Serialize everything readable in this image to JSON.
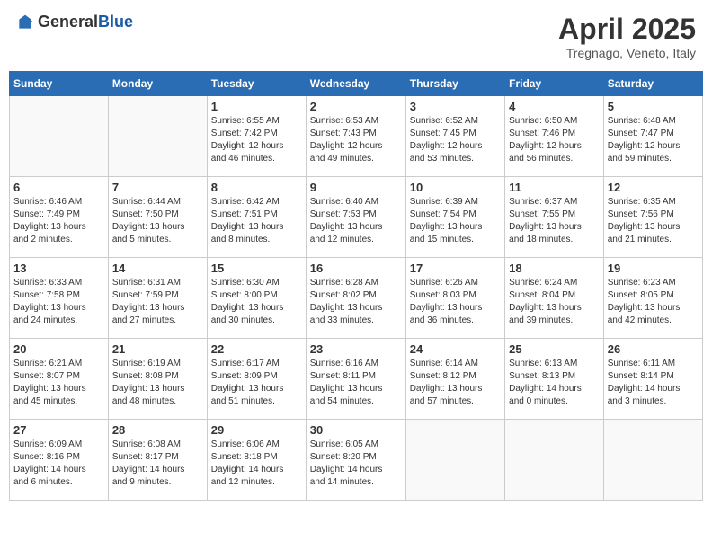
{
  "header": {
    "logo_general": "General",
    "logo_blue": "Blue",
    "title": "April 2025",
    "location": "Tregnago, Veneto, Italy"
  },
  "days_of_week": [
    "Sunday",
    "Monday",
    "Tuesday",
    "Wednesday",
    "Thursday",
    "Friday",
    "Saturday"
  ],
  "weeks": [
    [
      {
        "day": "",
        "info": ""
      },
      {
        "day": "",
        "info": ""
      },
      {
        "day": "1",
        "info": "Sunrise: 6:55 AM\nSunset: 7:42 PM\nDaylight: 12 hours\nand 46 minutes."
      },
      {
        "day": "2",
        "info": "Sunrise: 6:53 AM\nSunset: 7:43 PM\nDaylight: 12 hours\nand 49 minutes."
      },
      {
        "day": "3",
        "info": "Sunrise: 6:52 AM\nSunset: 7:45 PM\nDaylight: 12 hours\nand 53 minutes."
      },
      {
        "day": "4",
        "info": "Sunrise: 6:50 AM\nSunset: 7:46 PM\nDaylight: 12 hours\nand 56 minutes."
      },
      {
        "day": "5",
        "info": "Sunrise: 6:48 AM\nSunset: 7:47 PM\nDaylight: 12 hours\nand 59 minutes."
      }
    ],
    [
      {
        "day": "6",
        "info": "Sunrise: 6:46 AM\nSunset: 7:49 PM\nDaylight: 13 hours\nand 2 minutes."
      },
      {
        "day": "7",
        "info": "Sunrise: 6:44 AM\nSunset: 7:50 PM\nDaylight: 13 hours\nand 5 minutes."
      },
      {
        "day": "8",
        "info": "Sunrise: 6:42 AM\nSunset: 7:51 PM\nDaylight: 13 hours\nand 8 minutes."
      },
      {
        "day": "9",
        "info": "Sunrise: 6:40 AM\nSunset: 7:53 PM\nDaylight: 13 hours\nand 12 minutes."
      },
      {
        "day": "10",
        "info": "Sunrise: 6:39 AM\nSunset: 7:54 PM\nDaylight: 13 hours\nand 15 minutes."
      },
      {
        "day": "11",
        "info": "Sunrise: 6:37 AM\nSunset: 7:55 PM\nDaylight: 13 hours\nand 18 minutes."
      },
      {
        "day": "12",
        "info": "Sunrise: 6:35 AM\nSunset: 7:56 PM\nDaylight: 13 hours\nand 21 minutes."
      }
    ],
    [
      {
        "day": "13",
        "info": "Sunrise: 6:33 AM\nSunset: 7:58 PM\nDaylight: 13 hours\nand 24 minutes."
      },
      {
        "day": "14",
        "info": "Sunrise: 6:31 AM\nSunset: 7:59 PM\nDaylight: 13 hours\nand 27 minutes."
      },
      {
        "day": "15",
        "info": "Sunrise: 6:30 AM\nSunset: 8:00 PM\nDaylight: 13 hours\nand 30 minutes."
      },
      {
        "day": "16",
        "info": "Sunrise: 6:28 AM\nSunset: 8:02 PM\nDaylight: 13 hours\nand 33 minutes."
      },
      {
        "day": "17",
        "info": "Sunrise: 6:26 AM\nSunset: 8:03 PM\nDaylight: 13 hours\nand 36 minutes."
      },
      {
        "day": "18",
        "info": "Sunrise: 6:24 AM\nSunset: 8:04 PM\nDaylight: 13 hours\nand 39 minutes."
      },
      {
        "day": "19",
        "info": "Sunrise: 6:23 AM\nSunset: 8:05 PM\nDaylight: 13 hours\nand 42 minutes."
      }
    ],
    [
      {
        "day": "20",
        "info": "Sunrise: 6:21 AM\nSunset: 8:07 PM\nDaylight: 13 hours\nand 45 minutes."
      },
      {
        "day": "21",
        "info": "Sunrise: 6:19 AM\nSunset: 8:08 PM\nDaylight: 13 hours\nand 48 minutes."
      },
      {
        "day": "22",
        "info": "Sunrise: 6:17 AM\nSunset: 8:09 PM\nDaylight: 13 hours\nand 51 minutes."
      },
      {
        "day": "23",
        "info": "Sunrise: 6:16 AM\nSunset: 8:11 PM\nDaylight: 13 hours\nand 54 minutes."
      },
      {
        "day": "24",
        "info": "Sunrise: 6:14 AM\nSunset: 8:12 PM\nDaylight: 13 hours\nand 57 minutes."
      },
      {
        "day": "25",
        "info": "Sunrise: 6:13 AM\nSunset: 8:13 PM\nDaylight: 14 hours\nand 0 minutes."
      },
      {
        "day": "26",
        "info": "Sunrise: 6:11 AM\nSunset: 8:14 PM\nDaylight: 14 hours\nand 3 minutes."
      }
    ],
    [
      {
        "day": "27",
        "info": "Sunrise: 6:09 AM\nSunset: 8:16 PM\nDaylight: 14 hours\nand 6 minutes."
      },
      {
        "day": "28",
        "info": "Sunrise: 6:08 AM\nSunset: 8:17 PM\nDaylight: 14 hours\nand 9 minutes."
      },
      {
        "day": "29",
        "info": "Sunrise: 6:06 AM\nSunset: 8:18 PM\nDaylight: 14 hours\nand 12 minutes."
      },
      {
        "day": "30",
        "info": "Sunrise: 6:05 AM\nSunset: 8:20 PM\nDaylight: 14 hours\nand 14 minutes."
      },
      {
        "day": "",
        "info": ""
      },
      {
        "day": "",
        "info": ""
      },
      {
        "day": "",
        "info": ""
      }
    ]
  ]
}
